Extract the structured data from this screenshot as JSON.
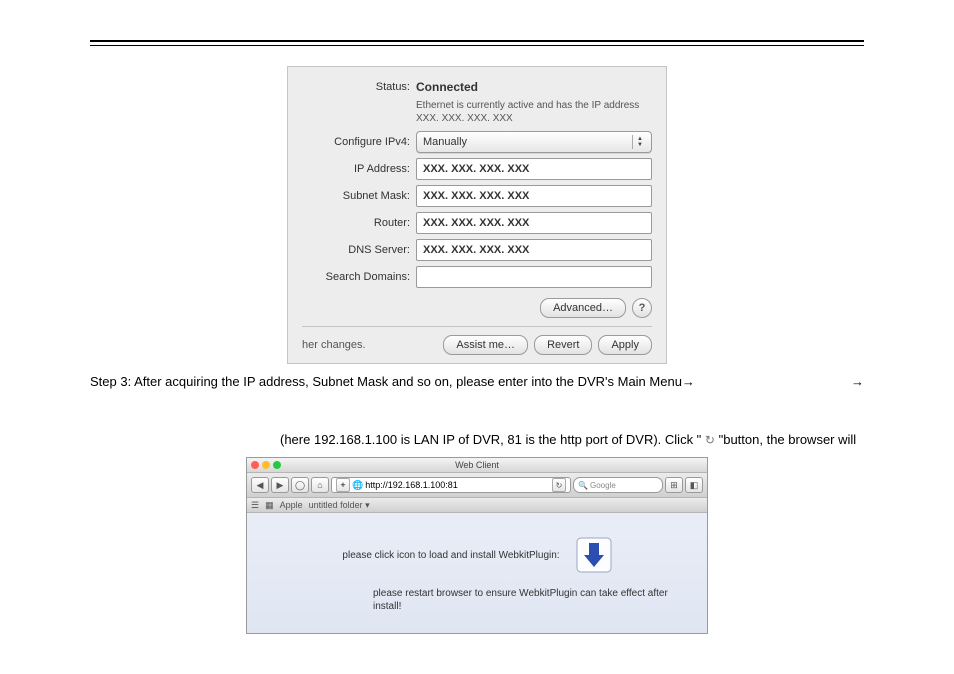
{
  "macPanel": {
    "labels": {
      "status": "Status:",
      "configure": "Configure IPv4:",
      "ip": "IP Address:",
      "subnet": "Subnet Mask:",
      "router": "Router:",
      "dns": "DNS Server:",
      "search": "Search Domains:"
    },
    "status_value": "Connected",
    "status_sub": "Ethernet is currently active and has the IP address XXX. XXX. XXX. XXX",
    "configure_value": "Manually",
    "ip": "XXX. XXX. XXX. XXX",
    "subnet": "XXX. XXX. XXX. XXX",
    "router": "XXX. XXX. XXX. XXX",
    "dns": "XXX. XXX. XXX. XXX",
    "search": "",
    "advanced": "Advanced…",
    "help": "?",
    "bottom_note": "her changes.",
    "assist": "Assist me…",
    "revert": "Revert",
    "apply": "Apply"
  },
  "step3_left": "Step 3: After acquiring the IP address, Subnet Mask and so on, please enter into the DVR's Main Menu",
  "arrow": "→",
  "midtext_a": "(here 192.168.1.100 is LAN IP of DVR, 81 is the http port of DVR). Click \" ",
  "midtext_b": " \"button, the browser will",
  "safari": {
    "title": "Web Client",
    "url": "http://192.168.1.100:81",
    "search_placeholder": "Google",
    "bookmarks": {
      "apple": "Apple",
      "folder": "untitled folder"
    },
    "plugin_msg": "please click icon to load and install WebkitPlugin:",
    "plugin_msg2": "please restart browser to ensure WebkitPlugin can take effect after install!"
  }
}
